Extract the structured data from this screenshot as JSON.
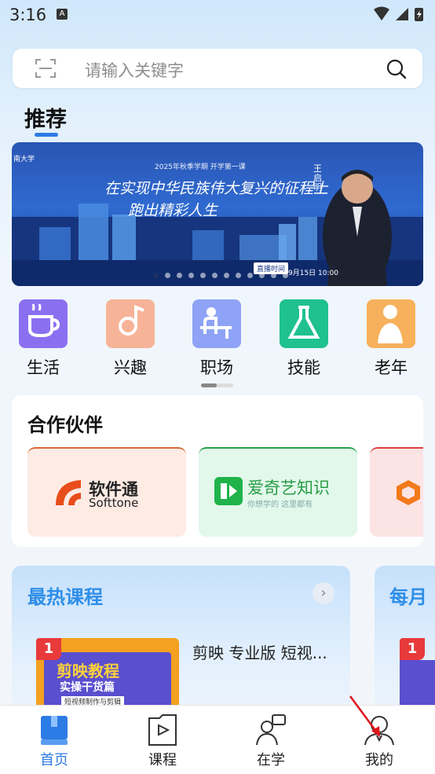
{
  "status_bar": {
    "time": "3:16",
    "notif_glyph": "A"
  },
  "search": {
    "placeholder": "请输入关键字",
    "scan_icon": "scan-icon",
    "search_icon": "search-icon"
  },
  "recommend_tab": {
    "label": "推荐"
  },
  "banner": {
    "headline_line1": "在实现中华民族伟大复兴的征程上",
    "headline_line2": "跑出精彩人生",
    "subtitle": "2025年秋季学期 开学第一课",
    "corner": "南大学",
    "person_name": "王启明",
    "live_tag": "直播时间",
    "live_date": "9月15日 10:00",
    "current_slide": 1,
    "slide_count": 12
  },
  "categories": [
    {
      "label": "生活",
      "icon": "coffee-cup-icon",
      "color": "#8a70f0"
    },
    {
      "label": "兴趣",
      "icon": "music-note-icon",
      "color": "#f7b398"
    },
    {
      "label": "职场",
      "icon": "desk-worker-icon",
      "color": "#8ea3f5"
    },
    {
      "label": "技能",
      "icon": "flask-icon",
      "color": "#1fc18e"
    },
    {
      "label": "老年",
      "icon": "elder-icon",
      "color": "#f7b15c"
    }
  ],
  "partners": {
    "title": "合作伙伴",
    "items": [
      {
        "name": "软件通",
        "subname": "Softtone",
        "bg": "#fdebe4"
      },
      {
        "name": "爱奇艺知识",
        "subname": "你想学的  这里都有",
        "bg": "#e2f8ea"
      },
      {
        "name": "",
        "subname": "",
        "bg": "#fde4e4"
      }
    ]
  },
  "hot_courses": {
    "title": "最热课程",
    "more_glyph": "›",
    "first": {
      "rank": "1",
      "thumb_title": "剪映教程",
      "thumb_sub": "实操干货篇",
      "thumb_tag": "短视频制作与剪辑",
      "title": "剪映 专业版 短视..."
    }
  },
  "monthly": {
    "title": "每月",
    "rank": "1"
  },
  "bottom_nav": [
    {
      "label": "首页",
      "icon": "book-icon",
      "active": true
    },
    {
      "label": "课程",
      "icon": "video-folder-icon",
      "active": false
    },
    {
      "label": "在学",
      "icon": "learning-person-icon",
      "active": false
    },
    {
      "label": "我的",
      "icon": "profile-icon",
      "active": false
    }
  ],
  "colors": {
    "accent": "#2d7be5",
    "hot_title": "#2f8ee8",
    "arrow": "#e0141e"
  }
}
